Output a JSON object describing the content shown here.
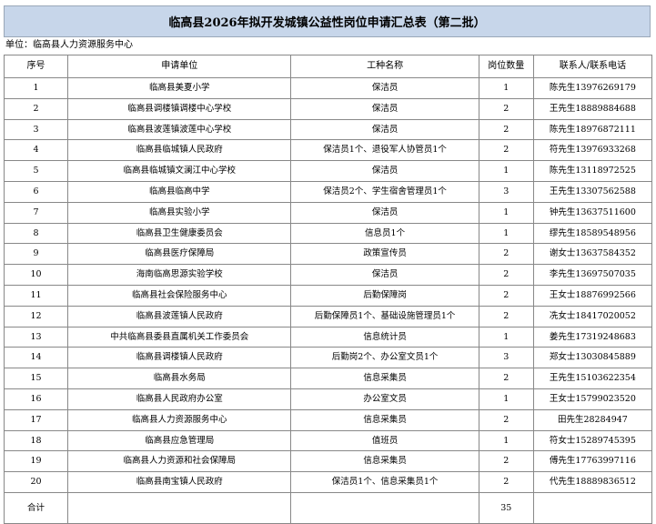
{
  "title": "临高县2026年拟开发城镇公益性岗位申请汇总表（第二批）",
  "unit_label": "单位：临高县人力资源服务中心",
  "headers": {
    "no": "序号",
    "unit": "申请单位",
    "job": "工种名称",
    "count": "岗位数量",
    "contact": "联系人/联系电话"
  },
  "rows": [
    {
      "no": "1",
      "unit": "临高县美夏小学",
      "job": "保洁员",
      "count": "1",
      "contact": "陈先生13976269179"
    },
    {
      "no": "2",
      "unit": "临高县调楼镇调楼中心学校",
      "job": "保洁员",
      "count": "2",
      "contact": "王先生18889884688"
    },
    {
      "no": "3",
      "unit": "临高县波莲镇波莲中心学校",
      "job": "保洁员",
      "count": "2",
      "contact": "陈先生18976872111"
    },
    {
      "no": "4",
      "unit": "临高县临城镇人民政府",
      "job": "保洁员1个、退役军人协管员1个",
      "count": "2",
      "contact": "符先生13976933268"
    },
    {
      "no": "5",
      "unit": "临高县临城镇文澜江中心学校",
      "job": "保洁员",
      "count": "1",
      "contact": "陈先生13118972525"
    },
    {
      "no": "6",
      "unit": "临高县临高中学",
      "job": "保洁员2个、学生宿舍管理员1个",
      "count": "3",
      "contact": "王先生13307562588"
    },
    {
      "no": "7",
      "unit": "临高县实验小学",
      "job": "保洁员",
      "count": "1",
      "contact": "钟先生13637511600"
    },
    {
      "no": "8",
      "unit": "临高县卫生健康委员会",
      "job": "信息员1个",
      "count": "1",
      "contact": "缪先生18589548956"
    },
    {
      "no": "9",
      "unit": "临高县医疗保障局",
      "job": "政策宣传员",
      "count": "2",
      "contact": "谢女士13637584352"
    },
    {
      "no": "10",
      "unit": "海南临高思源实验学校",
      "job": "保洁员",
      "count": "2",
      "contact": "李先生13697507035"
    },
    {
      "no": "11",
      "unit": "临高县社会保险服务中心",
      "job": "后勤保障岗",
      "count": "2",
      "contact": "王女士18876992566"
    },
    {
      "no": "12",
      "unit": "临高县波莲镇人民政府",
      "job": "后勤保障员1个、基础设施管理员1个",
      "count": "2",
      "contact": "冼女士18417020052"
    },
    {
      "no": "13",
      "unit": "中共临高县委县直属机关工作委员会",
      "job": "信息统计员",
      "count": "1",
      "contact": "姜先生17319248683"
    },
    {
      "no": "14",
      "unit": "临高县调楼镇人民政府",
      "job": "后勤岗2个、办公室文员1个",
      "count": "3",
      "contact": "郑女士13030845889"
    },
    {
      "no": "15",
      "unit": "临高县水务局",
      "job": "信息采集员",
      "count": "2",
      "contact": "王先生15103622354"
    },
    {
      "no": "16",
      "unit": "临高县人民政府办公室",
      "job": "办公室文员",
      "count": "1",
      "contact": "王女士15799023520"
    },
    {
      "no": "17",
      "unit": "临高县人力资源服务中心",
      "job": "信息采集员",
      "count": "2",
      "contact": "田先生28284947"
    },
    {
      "no": "18",
      "unit": "临高县应急管理局",
      "job": "值班员",
      "count": "1",
      "contact": "符女士15289745395"
    },
    {
      "no": "19",
      "unit": "临高县人力资源和社会保障局",
      "job": "信息采集员",
      "count": "2",
      "contact": "傅先生17763997116"
    },
    {
      "no": "20",
      "unit": "临高县南宝镇人民政府",
      "job": "保洁员1个、信息采集员1个",
      "count": "2",
      "contact": "代先生18889836512"
    }
  ],
  "total": {
    "label": "合计",
    "count": "35"
  },
  "colors": {
    "title_bg": "#c7d6ea",
    "border": "#888888"
  }
}
